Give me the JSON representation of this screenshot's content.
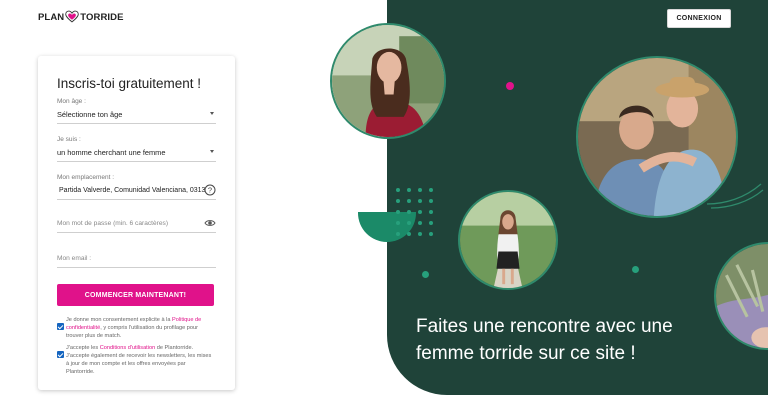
{
  "header": {
    "logo_left": "PLAN",
    "logo_right": "TORRIDE",
    "login_label": "CONNEXION"
  },
  "form": {
    "title": "Inscris-toi gratuitement !",
    "age": {
      "label": "Mon âge :",
      "value": "Sélectionne ton âge"
    },
    "iam": {
      "label": "Je suis :",
      "value": "un homme cherchant une femme"
    },
    "location": {
      "label": "Mon emplacement :",
      "value": "Partida Valverde, Comunidad Valenciana, 03139"
    },
    "password": {
      "placeholder": "Mon mot de passe (min. 6 caractères)"
    },
    "email": {
      "placeholder": "Mon email :"
    },
    "submit_label": "COMMENCER MAINTENANT!",
    "consent1": {
      "before": "Je donne mon consentement explicite à la ",
      "link": "Politique de confidentialité",
      "after": ", y compris l'utilisation du profilage pour trouver plus de match."
    },
    "consent2": {
      "before": "J'accepte les ",
      "link": "Conditions d'utilisation",
      "after": " de Plantorride. J'accepte également de recevoir les newsletters, les mises à jour de mon compte et les offres envoyées par Plantorride."
    }
  },
  "hero": {
    "headline": "Faites une rencontre avec une femme torride sur ce site !"
  },
  "colors": {
    "brand_pink": "#e0128a",
    "panel_green": "#1f4339",
    "accent_green": "#27a07c"
  }
}
